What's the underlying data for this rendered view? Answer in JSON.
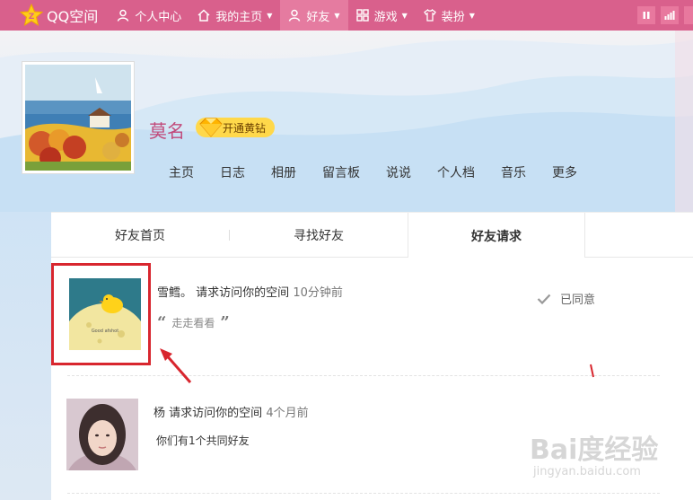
{
  "topbar": {
    "logo_text": "QQ空间",
    "nav": [
      {
        "label": "个人中心",
        "icon": "person-icon"
      },
      {
        "label": "我的主页",
        "icon": "home-icon"
      },
      {
        "label": "好友",
        "icon": "friends-icon"
      },
      {
        "label": "游戏",
        "icon": "grid-icon"
      },
      {
        "label": "装扮",
        "icon": "shirt-icon"
      }
    ],
    "bg_color": "#d9608c",
    "active_color": "#e57ba0"
  },
  "profile": {
    "name": "莫名",
    "vip_label": "开通黄钻",
    "nav": [
      "主页",
      "日志",
      "相册",
      "留言板",
      "说说",
      "个人档",
      "音乐",
      "更多"
    ]
  },
  "tabs": [
    "好友首页",
    "寻找好友",
    "好友请求"
  ],
  "requests": [
    {
      "name": "雪鳕。",
      "action": "请求访问你的空间",
      "time": "10分钟前",
      "message": "走走看看",
      "status": "已同意",
      "avatar_text": "Good afshot"
    },
    {
      "name": "杨",
      "action": "请求访问你的空间",
      "time": "4个月前",
      "mutual": "你们有1个共同好友"
    }
  ],
  "watermark": {
    "brand": "Bai度经验",
    "url": "jingyan.baidu.com"
  }
}
